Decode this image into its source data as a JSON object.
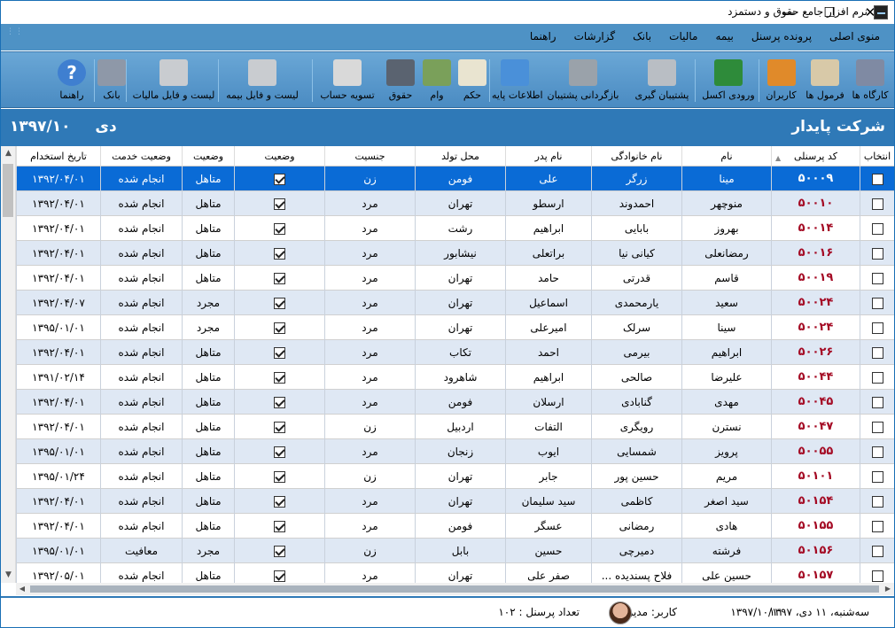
{
  "window": {
    "title": "نرم افزار جامع حقوق و دستمزد",
    "minimize": "—",
    "maximize": "☐",
    "close": "✕"
  },
  "menu": [
    "منوی اصلی",
    "پرونده پرسنل",
    "بیمه",
    "مالیات",
    "بانک",
    "گزارشات",
    "راهنما"
  ],
  "toolbar": [
    {
      "label": "کارگاه ها",
      "icon": "buildings-icon",
      "color": "#7f8aa3"
    },
    {
      "label": "فرمول ها",
      "icon": "formula-icon",
      "color": "#d8c9a8"
    },
    {
      "label": "کاربران",
      "icon": "users-icon",
      "color": "#e08a2a"
    },
    {
      "label": "ورودی اکسل",
      "icon": "excel-icon",
      "color": "#2e8b3a"
    },
    {
      "label": "پشتیبان گیری",
      "icon": "backup-disk-icon",
      "color": "#b9bec4"
    },
    {
      "label": "بازگردانی پشتیبان",
      "icon": "restore-icon",
      "color": "#9aa2aa"
    },
    {
      "label": "اطلاعات پایه",
      "icon": "base-info-icon",
      "color": "#4a90d9"
    },
    {
      "label": "حکم",
      "icon": "decree-pen-icon",
      "color": "#e9e4d0"
    },
    {
      "label": "وام",
      "icon": "money-stack-icon",
      "color": "#7aa05a"
    },
    {
      "label": "حقوق",
      "icon": "calculator-icon",
      "color": "#5a6370"
    },
    {
      "label": "تسویه حساب",
      "icon": "settlement-paper-icon",
      "color": "#d9d9d9"
    },
    {
      "label": "لیست و فایل بیمه",
      "icon": "insurance-printer-icon",
      "color": "#c9ccd0"
    },
    {
      "label": "لیست و فایل مالیات",
      "icon": "tax-printer-icon",
      "color": "#c9ccd0"
    },
    {
      "label": "بانک",
      "icon": "bank-icon",
      "color": "#8e98a8"
    },
    {
      "label": "راهنما",
      "icon": "help-icon",
      "color": "#3f7fd0"
    }
  ],
  "band": {
    "company": "شرکت پایدار",
    "month": "دی",
    "year": "۱۳۹۷/۱۰"
  },
  "columns": [
    "انتخاب",
    "کد پرسنلی",
    "نام",
    "نام خانوادگی",
    "نام پدر",
    "محل تولد",
    "جنسیت",
    "وضعیت",
    "وضعیت",
    "وضعیت خدمت",
    "تاریخ استخدام"
  ],
  "rows": [
    {
      "code": "۵۰۰۰۹",
      "name": "مینا",
      "family": "زرگر",
      "father": "علی",
      "birth": "فومن",
      "gender": "زن",
      "checked": true,
      "marital": "متاهل",
      "service": "انجام شده",
      "date": "۱۳۹۲/۰۴/۰۱"
    },
    {
      "code": "۵۰۰۱۰",
      "name": "منوچهر",
      "family": "احمدوند",
      "father": "ارسطو",
      "birth": "تهران",
      "gender": "مرد",
      "checked": true,
      "marital": "متاهل",
      "service": "انجام شده",
      "date": "۱۳۹۲/۰۴/۰۱"
    },
    {
      "code": "۵۰۰۱۴",
      "name": "بهروز",
      "family": "بابایی",
      "father": "ابراهیم",
      "birth": "رشت",
      "gender": "مرد",
      "checked": true,
      "marital": "متاهل",
      "service": "انجام شده",
      "date": "۱۳۹۲/۰۴/۰۱"
    },
    {
      "code": "۵۰۰۱۶",
      "name": "رمضانعلی",
      "family": "کیانی نیا",
      "father": "براتعلی",
      "birth": "نیشابور",
      "gender": "مرد",
      "checked": true,
      "marital": "متاهل",
      "service": "انجام شده",
      "date": "۱۳۹۲/۰۴/۰۱"
    },
    {
      "code": "۵۰۰۱۹",
      "name": "قاسم",
      "family": "قدرتی",
      "father": "حامد",
      "birth": "تهران",
      "gender": "مرد",
      "checked": true,
      "marital": "متاهل",
      "service": "انجام شده",
      "date": "۱۳۹۲/۰۴/۰۱"
    },
    {
      "code": "۵۰۰۲۴",
      "name": "سعید",
      "family": "یارمحمدی",
      "father": "اسماعیل",
      "birth": "تهران",
      "gender": "مرد",
      "checked": true,
      "marital": "مجرد",
      "service": "انجام شده",
      "date": "۱۳۹۲/۰۴/۰۷"
    },
    {
      "code": "۵۰۰۲۴",
      "name": "سینا",
      "family": "سرلک",
      "father": "امیرعلی",
      "birth": "تهران",
      "gender": "مرد",
      "checked": true,
      "marital": "مجرد",
      "service": "انجام شده",
      "date": "۱۳۹۵/۰۱/۰۱"
    },
    {
      "code": "۵۰۰۲۶",
      "name": "ابراهیم",
      "family": "بیرمی",
      "father": "احمد",
      "birth": "تکاب",
      "gender": "مرد",
      "checked": true,
      "marital": "متاهل",
      "service": "انجام شده",
      "date": "۱۳۹۲/۰۴/۰۱"
    },
    {
      "code": "۵۰۰۴۴",
      "name": "علیرضا",
      "family": "صالحی",
      "father": "ابراهیم",
      "birth": "شاهرود",
      "gender": "مرد",
      "checked": true,
      "marital": "متاهل",
      "service": "انجام شده",
      "date": "۱۳۹۱/۰۲/۱۴"
    },
    {
      "code": "۵۰۰۴۵",
      "name": "مهدی",
      "family": "گنابادی",
      "father": "ارسلان",
      "birth": "فومن",
      "gender": "مرد",
      "checked": true,
      "marital": "متاهل",
      "service": "انجام شده",
      "date": "۱۳۹۲/۰۴/۰۱"
    },
    {
      "code": "۵۰۰۴۷",
      "name": "نسترن",
      "family": "رویگری",
      "father": "التفات",
      "birth": "اردبیل",
      "gender": "زن",
      "checked": true,
      "marital": "متاهل",
      "service": "انجام شده",
      "date": "۱۳۹۲/۰۴/۰۱"
    },
    {
      "code": "۵۰۰۵۵",
      "name": "پرویز",
      "family": "شمسایی",
      "father": "ایوب",
      "birth": "زنجان",
      "gender": "مرد",
      "checked": true,
      "marital": "متاهل",
      "service": "انجام شده",
      "date": "۱۳۹۵/۰۱/۰۱"
    },
    {
      "code": "۵۰۱۰۱",
      "name": "مریم",
      "family": "حسین پور",
      "father": "جابر",
      "birth": "تهران",
      "gender": "زن",
      "checked": true,
      "marital": "متاهل",
      "service": "انجام شده",
      "date": "۱۳۹۵/۰۱/۲۴"
    },
    {
      "code": "۵۰۱۵۴",
      "name": "سید اصغر",
      "family": "کاظمی",
      "father": "سید سلیمان",
      "birth": "تهران",
      "gender": "مرد",
      "checked": true,
      "marital": "متاهل",
      "service": "انجام شده",
      "date": "۱۳۹۲/۰۴/۰۱"
    },
    {
      "code": "۵۰۱۵۵",
      "name": "هادی",
      "family": "رمضانی",
      "father": "عسگر",
      "birth": "فومن",
      "gender": "مرد",
      "checked": true,
      "marital": "متاهل",
      "service": "انجام شده",
      "date": "۱۳۹۲/۰۴/۰۱"
    },
    {
      "code": "۵۰۱۵۶",
      "name": "فرشته",
      "family": "دمیرچی",
      "father": "حسین",
      "birth": "بابل",
      "gender": "زن",
      "checked": true,
      "marital": "مجرد",
      "service": "معافیت",
      "date": "۱۳۹۵/۰۱/۰۱"
    },
    {
      "code": "۵۰۱۵۷",
      "name": "حسین علی",
      "family": "فلاح پسندیده ...",
      "father": "صفر علی",
      "birth": "تهران",
      "gender": "مرد",
      "checked": true,
      "marital": "متاهل",
      "service": "انجام شده",
      "date": "۱۳۹۲/۰۵/۰۱"
    }
  ],
  "status": {
    "day": "سه‌شنبه، ۱۱ دی، ۱۳۹۷",
    "date": "۱۳۹۷/۱۰/۱۱",
    "user": "کاربر: مدیر",
    "count": "تعداد پرسنل : ۱۰۲"
  }
}
